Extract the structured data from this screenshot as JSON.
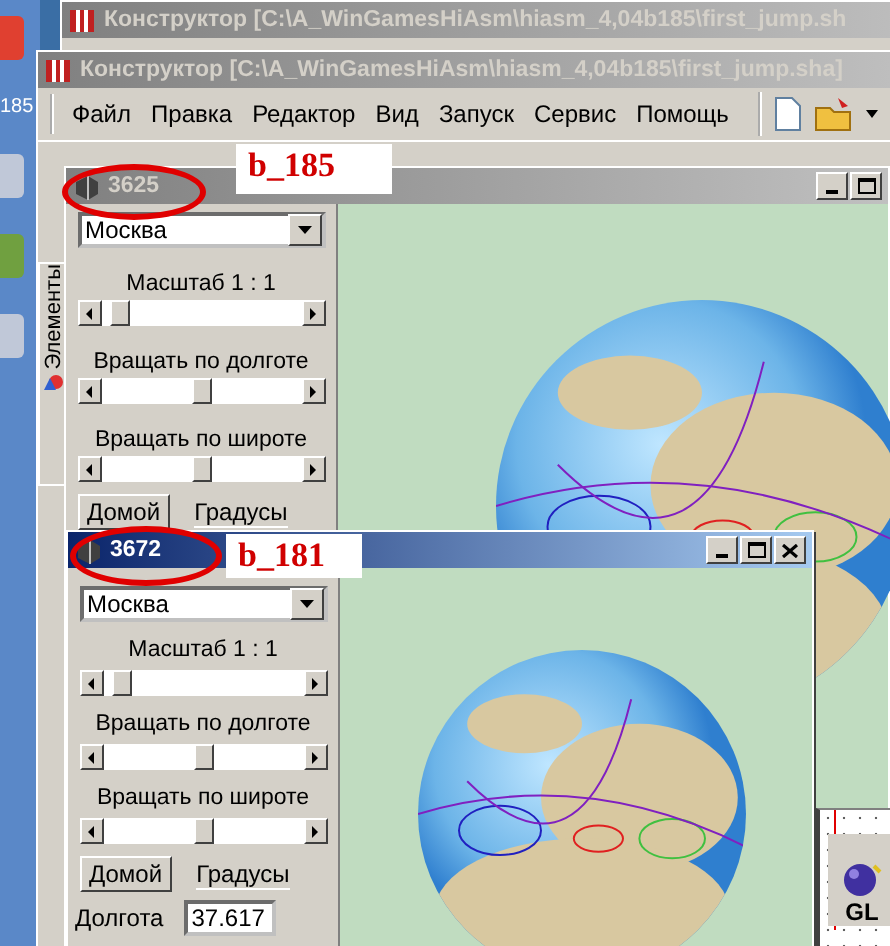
{
  "desktop": {
    "label": "185"
  },
  "back_window": {
    "title": "Конструктор [C:\\A_WinGamesHiAsm\\hiasm_4,04b185\\first_jump.sh",
    "active": false
  },
  "main_window": {
    "title": "Конструктор [C:\\A_WinGamesHiAsm\\hiasm_4,04b185\\first_jump.sha]",
    "active": false,
    "menu": [
      "Файл",
      "Правка",
      "Редактор",
      "Вид",
      "Запуск",
      "Сервис",
      "Помощь"
    ],
    "side_tab": "Элементы"
  },
  "globe_windows": [
    {
      "title": "3625",
      "active": false,
      "annotation": "b_185",
      "close_button": false,
      "city": "Москва",
      "sliders": [
        {
          "label": "Масштаб 1 : 1",
          "level": 0.05
        },
        {
          "label": "Вращать по долготе",
          "level": 0.5
        },
        {
          "label": "Вращать по широте",
          "level": 0.5
        }
      ],
      "home_button": "Домой",
      "degrees_label": "Градусы"
    },
    {
      "title": "3672",
      "active": true,
      "annotation": "b_181",
      "close_button": true,
      "city": "Москва",
      "sliders": [
        {
          "label": "Масштаб 1 : 1",
          "level": 0.05
        },
        {
          "label": "Вращать по долготе",
          "level": 0.5
        },
        {
          "label": "Вращать по широте",
          "level": 0.5
        }
      ],
      "home_button": "Домой",
      "degrees_label": "Градусы",
      "longitude_label": "Долгота",
      "longitude_value": "37.617"
    }
  ],
  "component": {
    "label": "GL"
  }
}
